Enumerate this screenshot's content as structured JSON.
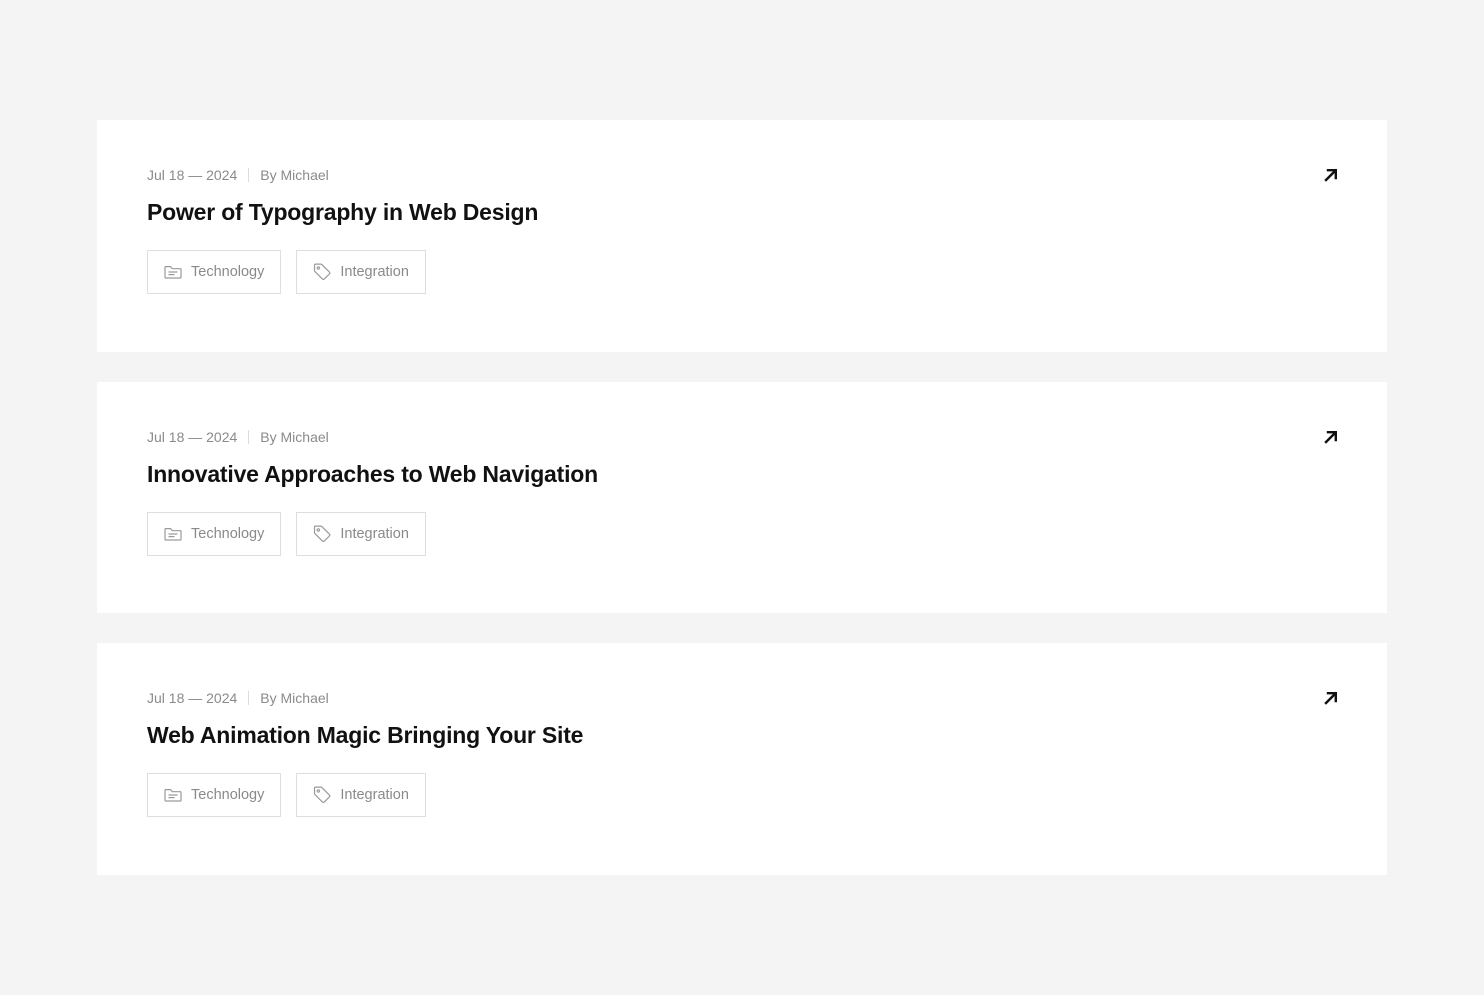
{
  "posts": [
    {
      "date": "Jul 18 — 2024",
      "author": "By Michael",
      "title": "Power of Typography in Web Design",
      "category": "Technology",
      "tag": "Integration"
    },
    {
      "date": "Jul 18 — 2024",
      "author": "By Michael",
      "title": "Innovative Approaches to Web Navigation",
      "category": "Technology",
      "tag": "Integration"
    },
    {
      "date": "Jul 18 — 2024",
      "author": "By Michael",
      "title": "Web Animation Magic Bringing Your Site",
      "category": "Technology",
      "tag": "Integration"
    }
  ],
  "icons": {
    "category": "folder-icon",
    "tag": "tag-icon",
    "link": "arrow-up-right-icon"
  },
  "colors": {
    "background": "#f4f4f4",
    "card": "#ffffff",
    "title": "#111111",
    "muted": "#8a8a8a",
    "border": "#dedede"
  }
}
